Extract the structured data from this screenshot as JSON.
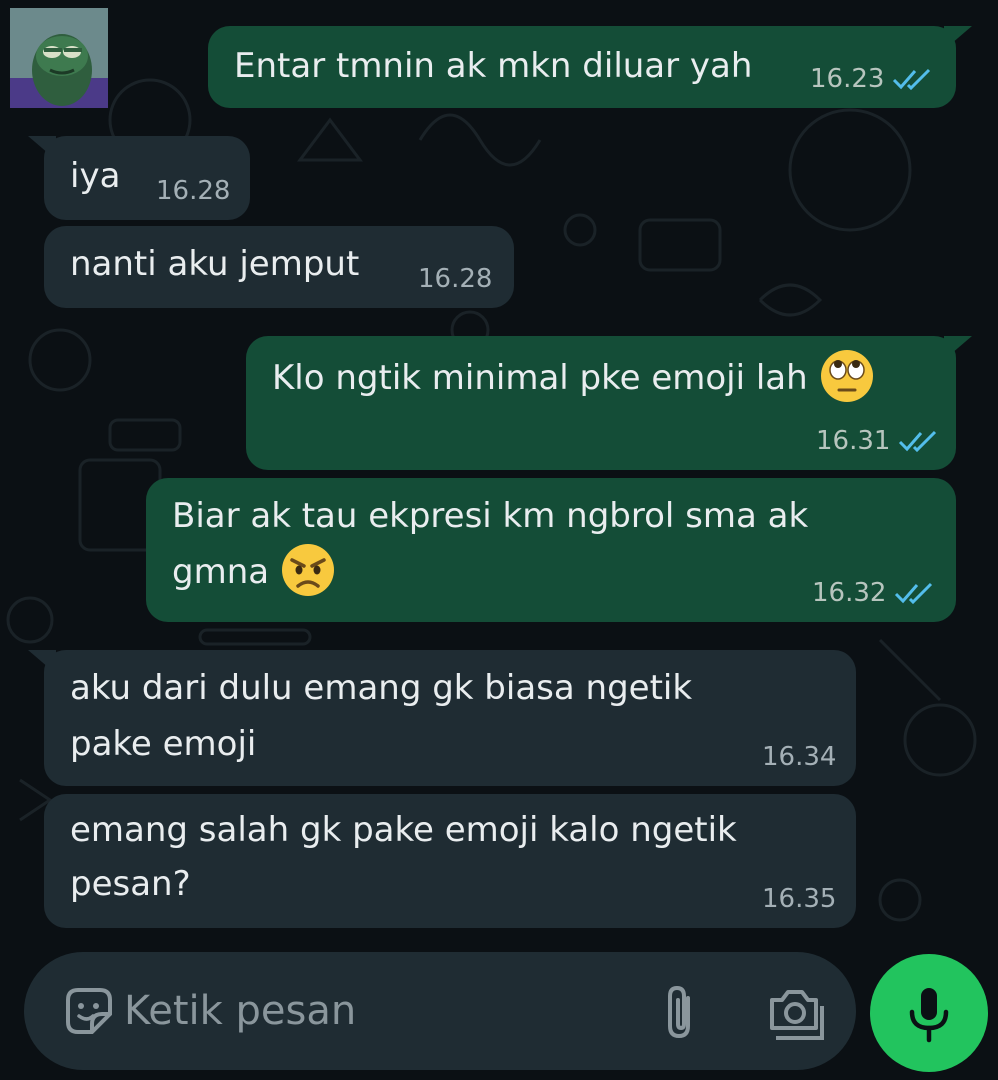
{
  "contact": {
    "avatar_icon": "fish-sticker-avatar"
  },
  "messages": [
    {
      "direction": "out",
      "text": "Entar tmnin ak mkn diluar yah",
      "time": "16.23",
      "status": "read"
    },
    {
      "direction": "in",
      "text": "iya",
      "time": "16.28"
    },
    {
      "direction": "in",
      "text": "nanti aku jemput",
      "time": "16.28"
    },
    {
      "direction": "out",
      "text": "Klo ngtik minimal pke emoji lah",
      "emoji": "face-with-rolling-eyes",
      "time": "16.31",
      "status": "read"
    },
    {
      "direction": "out",
      "line1": "Biar ak tau ekpresi km ngbrol sma ak",
      "line2": "gmna",
      "emoji": "angry-face",
      "time": "16.32",
      "status": "read"
    },
    {
      "direction": "in",
      "line1": "aku dari dulu emang gk biasa ngetik",
      "line2": "pake emoji",
      "time": "16.34"
    },
    {
      "direction": "in",
      "line1": "emang salah gk pake emoji kalo ngetik",
      "line2": "pesan?",
      "time": "16.35"
    }
  ],
  "composer": {
    "placeholder": "Ketik pesan",
    "icons": [
      "sticker-icon",
      "attach-icon",
      "camera-icon",
      "mic-icon"
    ]
  },
  "colors": {
    "background": "#0b1014",
    "outgoing_bubble": "#144d37",
    "incoming_bubble": "#1f2c33",
    "read_ticks": "#53bdeb",
    "mic_button": "#22c45e"
  }
}
